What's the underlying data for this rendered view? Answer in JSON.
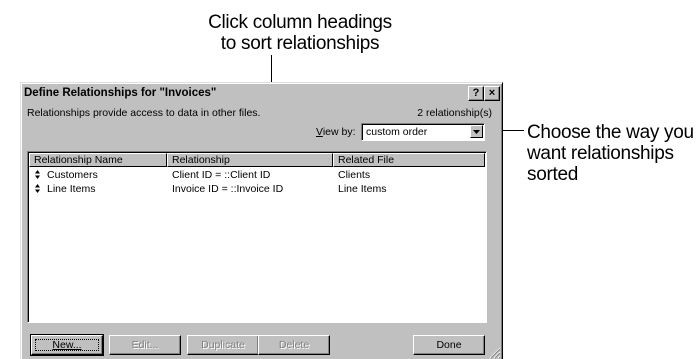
{
  "callouts": {
    "top_line1": "Click column headings",
    "top_line2": "to sort relationships",
    "right_line1": "Choose the way you",
    "right_line2": "want relationships",
    "right_line3": "sorted"
  },
  "dialog": {
    "title": "Define Relationships for \"Invoices\"",
    "help_button": "?",
    "close_button": "×",
    "description": "Relationships provide access to data in other files.",
    "count": "2 relationship(s)",
    "viewby_label_prefix": "V",
    "viewby_label_rest": "iew by:",
    "viewby_value": "custom order"
  },
  "table": {
    "headers": [
      "Relationship Name",
      "Relationship",
      "Related File"
    ],
    "rows": [
      {
        "name": "Customers",
        "relationship": "Client ID = ::Client ID",
        "file": "Clients"
      },
      {
        "name": "Line Items",
        "relationship": "Invoice ID = ::Invoice ID",
        "file": "Line Items"
      }
    ]
  },
  "buttons": {
    "new": "New...",
    "edit": "Edit...",
    "duplicate": "Duplicate",
    "delete": "Delete",
    "done": "Done"
  }
}
